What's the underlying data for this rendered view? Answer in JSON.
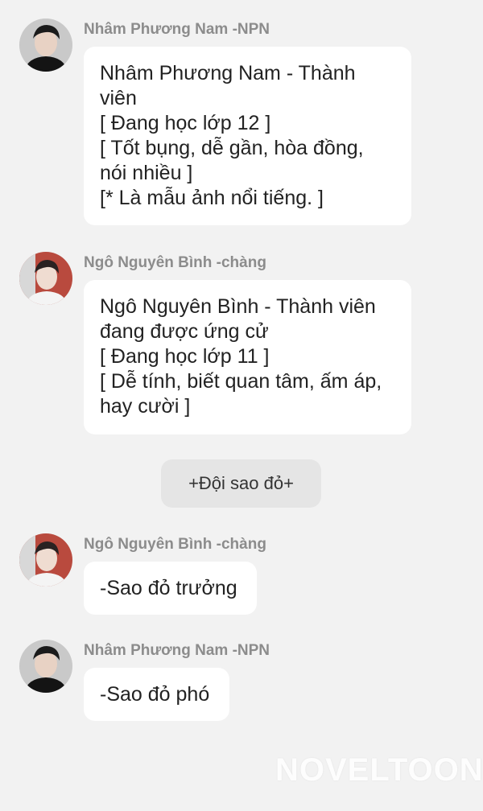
{
  "messages": [
    {
      "sender": "Nhâm Phương Nam -NPN",
      "lines": [
        "Nhâm Phương Nam - Thành",
        "viên",
        "[ Đang học lớp 12 ]",
        "[ Tốt bụng, dễ gần, hòa đồng,",
        "nói nhiều ]",
        "[* Là mẫu ảnh nổi tiếng. ]"
      ]
    },
    {
      "sender": "Ngô Nguyên Bình -chàng",
      "lines": [
        "Ngô Nguyên Bình - Thành viên",
        "đang được ứng cử",
        "[ Đang học lớp 11 ]",
        "[ Dễ tính, biết quan tâm, ấm áp,",
        "hay cười ]"
      ]
    },
    {
      "sender": "Ngô Nguyên Bình -chàng",
      "lines": [
        "-Sao đỏ trưởng"
      ]
    },
    {
      "sender": "Nhâm Phương Nam -NPN",
      "lines": [
        "-Sao đỏ phó"
      ]
    }
  ],
  "system_message": "+Đội sao đỏ+",
  "watermark": "NOVELTOON"
}
